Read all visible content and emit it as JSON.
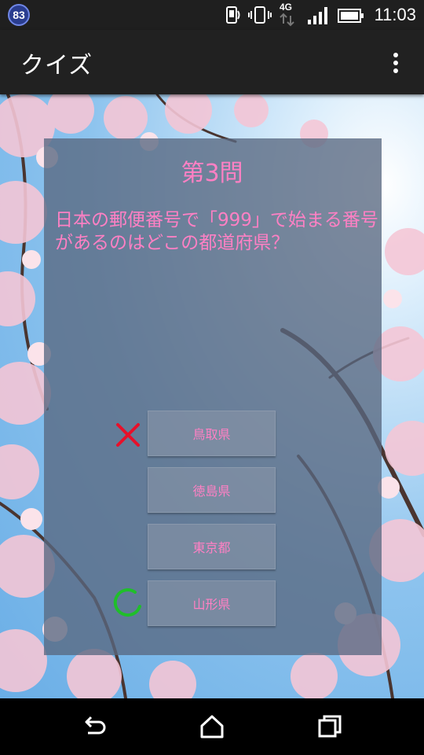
{
  "status_bar": {
    "notification_count": "83",
    "network_label": "4G",
    "time": "11:03"
  },
  "app_bar": {
    "title": "クイズ"
  },
  "quiz": {
    "question_number": "第3問",
    "question_text": "日本の郵便番号で「999」で始まる番号があるのはどこの都道府県？",
    "choices": [
      {
        "label": "鳥取県",
        "mark": "wrong"
      },
      {
        "label": "徳島県",
        "mark": ""
      },
      {
        "label": "東京都",
        "mark": ""
      },
      {
        "label": "山形県",
        "mark": "correct"
      }
    ]
  },
  "colors": {
    "accent_text": "#ff80c4",
    "wrong_mark": "#e8102a",
    "correct_mark": "#1fbf2a"
  },
  "icons": {
    "wrong": "cross-icon",
    "correct": "circle-icon",
    "nav_back": "back-icon",
    "nav_home": "home-icon",
    "nav_recents": "recents-icon"
  }
}
